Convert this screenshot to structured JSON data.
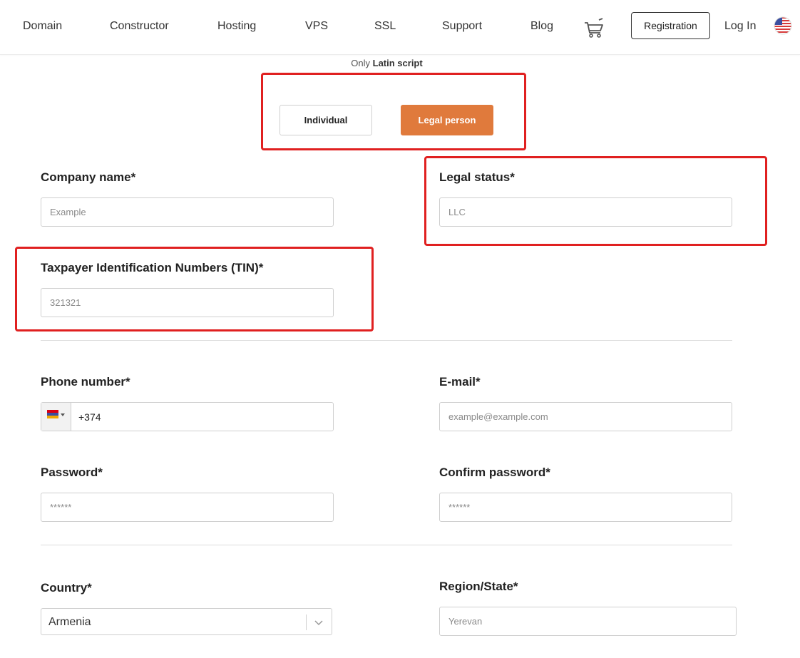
{
  "nav": {
    "links": [
      "Domain",
      "Constructor",
      "Hosting",
      "VPS",
      "SSL",
      "Support",
      "Blog"
    ],
    "cart_icon": "cart-icon",
    "registration_label": "Registration",
    "login_label": "Log In",
    "language_icon": "us-flag-icon"
  },
  "hint": {
    "prefix": "Only",
    "emphasis": "Latin script"
  },
  "entity_type": {
    "individual_label": "Individual",
    "legal_label": "Legal person",
    "selected": "Legal person",
    "accent_color": "#e07a3c"
  },
  "form": {
    "company_name": {
      "label": "Company name*",
      "placeholder": "Example"
    },
    "legal_status": {
      "label": "Legal status*",
      "placeholder": "LLC"
    },
    "tin": {
      "label": "Taxpayer Identification Numbers (TIN)*",
      "placeholder": "321321"
    },
    "phone": {
      "label": "Phone number*",
      "value": "+374",
      "flag_icon": "armenia-flag-icon"
    },
    "email": {
      "label": "E-mail*",
      "placeholder": "example@example.com"
    },
    "password": {
      "label": "Password*",
      "placeholder": "******"
    },
    "confirm_password": {
      "label": "Confirm password*",
      "placeholder": "******"
    },
    "country": {
      "label": "Country*",
      "value": "Armenia"
    },
    "region": {
      "label": "Region/State*",
      "placeholder": "Yerevan"
    }
  },
  "highlight_color": "#e02020"
}
